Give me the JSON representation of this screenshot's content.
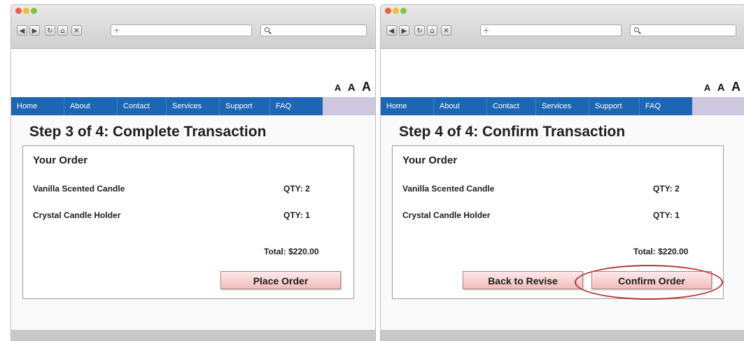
{
  "windows": {
    "left": {
      "nav": [
        "Home",
        "About",
        "Contact",
        "Services",
        "Support",
        "FAQ"
      ],
      "font_sizes": [
        "A",
        "A",
        "A"
      ],
      "step_title": "Step 3 of 4: Complete Transaction",
      "order": {
        "title": "Your Order",
        "items": [
          {
            "name": "Vanilla Scented Candle",
            "qty": "QTY: 2"
          },
          {
            "name": "Crystal Candle Holder",
            "qty": "QTY: 1"
          }
        ],
        "total": "Total: $220.00"
      },
      "buttons": {
        "place_order": "Place Order"
      }
    },
    "right": {
      "nav": [
        "Home",
        "About",
        "Contact",
        "Services",
        "Support",
        "FAQ"
      ],
      "font_sizes": [
        "A",
        "A",
        "A"
      ],
      "step_title": "Step 4 of 4: Confirm Transaction",
      "order": {
        "title": "Your Order",
        "items": [
          {
            "name": "Vanilla Scented Candle",
            "qty": "QTY: 2"
          },
          {
            "name": "Crystal Candle Holder",
            "qty": "QTY: 1"
          }
        ],
        "total": "Total: $220.00"
      },
      "buttons": {
        "back_to_revise": "Back to Revise",
        "confirm_order": "Confirm Order"
      }
    }
  },
  "browser": {
    "toolbar_icons": [
      "back-arrow-icon",
      "forward-arrow-icon",
      "reload-icon",
      "home-icon",
      "close-icon",
      "new-tab-plus-icon",
      "search-icon"
    ],
    "glyphs": {
      "back": "◀",
      "forward": "▶",
      "reload": "↻",
      "home": "⌂",
      "close": "✕",
      "plus": "+"
    }
  },
  "colors": {
    "nav_bar": "#1d66b3",
    "nav_tail": "#cfc6e0",
    "button_fill": "#f2bcbc",
    "highlight_ellipse": "#b63535"
  }
}
